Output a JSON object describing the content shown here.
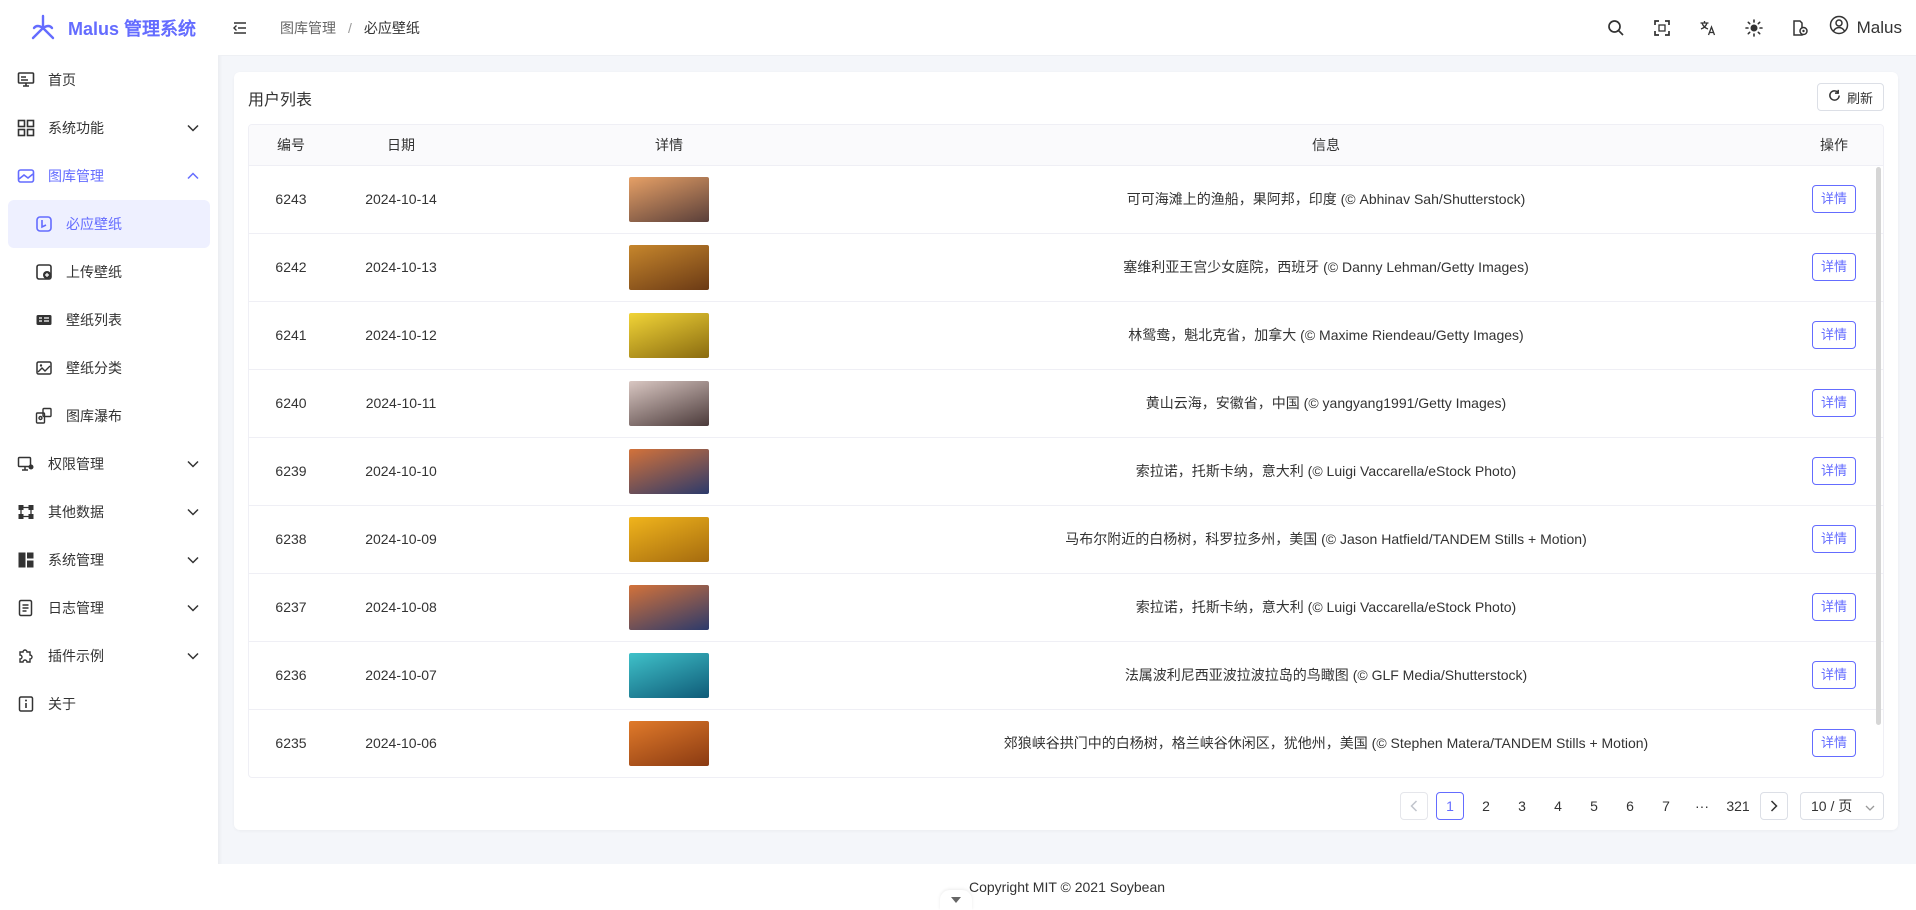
{
  "app": {
    "title": "Malus 管理系统"
  },
  "sidebar": {
    "items": [
      {
        "label": "首页",
        "icon": "monitor-icon"
      },
      {
        "label": "系统功能",
        "icon": "grid-icon"
      },
      {
        "label": "图库管理",
        "icon": "image-icon"
      },
      {
        "label": "权限管理",
        "icon": "key-monitor-icon"
      },
      {
        "label": "其他数据",
        "icon": "nodes-icon"
      },
      {
        "label": "系统管理",
        "icon": "layout-icon"
      },
      {
        "label": "日志管理",
        "icon": "log-icon"
      },
      {
        "label": "插件示例",
        "icon": "puzzle-icon"
      },
      {
        "label": "关于",
        "icon": "info-icon"
      }
    ],
    "gallery_children": [
      {
        "label": "必应壁纸",
        "icon": "bing-icon"
      },
      {
        "label": "上传壁纸",
        "icon": "upload-icon"
      },
      {
        "label": "壁纸列表",
        "icon": "list-icon"
      },
      {
        "label": "壁纸分类",
        "icon": "category-icon"
      },
      {
        "label": "图库瀑布",
        "icon": "waterfall-icon"
      }
    ]
  },
  "header": {
    "breadcrumb": [
      "图库管理",
      "必应壁纸"
    ],
    "breadcrumb_sep": "/",
    "user": "Malus"
  },
  "card": {
    "title": "用户列表",
    "refresh_label": "刷新"
  },
  "table": {
    "columns": [
      "编号",
      "日期",
      "详情",
      "信息",
      "操作"
    ],
    "action_label": "详情",
    "rows": [
      {
        "id": "6243",
        "date": "2024-10-14",
        "info": "可可海滩上的渔船，果阿邦，印度 (© Abhinav Sah/Shutterstock)",
        "thumb": [
          "#e6a066",
          "#5a3f3a"
        ]
      },
      {
        "id": "6242",
        "date": "2024-10-13",
        "info": "塞维利亚王宫少女庭院，西班牙 (© Danny Lehman/Getty Images)",
        "thumb": [
          "#c6862c",
          "#6b3a15"
        ]
      },
      {
        "id": "6241",
        "date": "2024-10-12",
        "info": "林鸳鸯，魁北克省，加拿大 (© Maxime Riendeau/Getty Images)",
        "thumb": [
          "#f1d437",
          "#8a6b10"
        ]
      },
      {
        "id": "6240",
        "date": "2024-10-11",
        "info": "黄山云海，安徽省，中国 (© yangyang1991/Getty Images)",
        "thumb": [
          "#d9c7c2",
          "#4b3a3a"
        ]
      },
      {
        "id": "6239",
        "date": "2024-10-10",
        "info": "索拉诺，托斯卡纳，意大利 (© Luigi Vaccarella/eStock Photo)",
        "thumb": [
          "#d3723a",
          "#2c3a6b"
        ]
      },
      {
        "id": "6238",
        "date": "2024-10-09",
        "info": "马布尔附近的白杨树，科罗拉多州，美国 (© Jason Hatfield/TANDEM Stills + Motion)",
        "thumb": [
          "#f0b41c",
          "#a56b0f"
        ]
      },
      {
        "id": "6237",
        "date": "2024-10-08",
        "info": "索拉诺，托斯卡纳，意大利 (© Luigi Vaccarella/eStock Photo)",
        "thumb": [
          "#d3723a",
          "#2c3a6b"
        ]
      },
      {
        "id": "6236",
        "date": "2024-10-07",
        "info": "法属波利尼西亚波拉波拉岛的鸟瞰图 (© GLF Media/Shutterstock)",
        "thumb": [
          "#3fc1c9",
          "#0f5b78"
        ]
      },
      {
        "id": "6235",
        "date": "2024-10-06",
        "info": "郊狼峡谷拱门中的白杨树，格兰峡谷休闲区，犹他州，美国 (© Stephen Matera/TANDEM Stills + Motion)",
        "thumb": [
          "#e07a2a",
          "#8a3a12"
        ]
      }
    ]
  },
  "pagination": {
    "pages": [
      "1",
      "2",
      "3",
      "4",
      "5",
      "6",
      "7"
    ],
    "ellipsis": "···",
    "last_page": "321",
    "current": "1",
    "page_size": "10 / 页"
  },
  "footer": {
    "text": "Copyright MIT © 2021 Soybean"
  },
  "colors": {
    "accent": "#646cff",
    "bg": "#f4f6fa"
  }
}
